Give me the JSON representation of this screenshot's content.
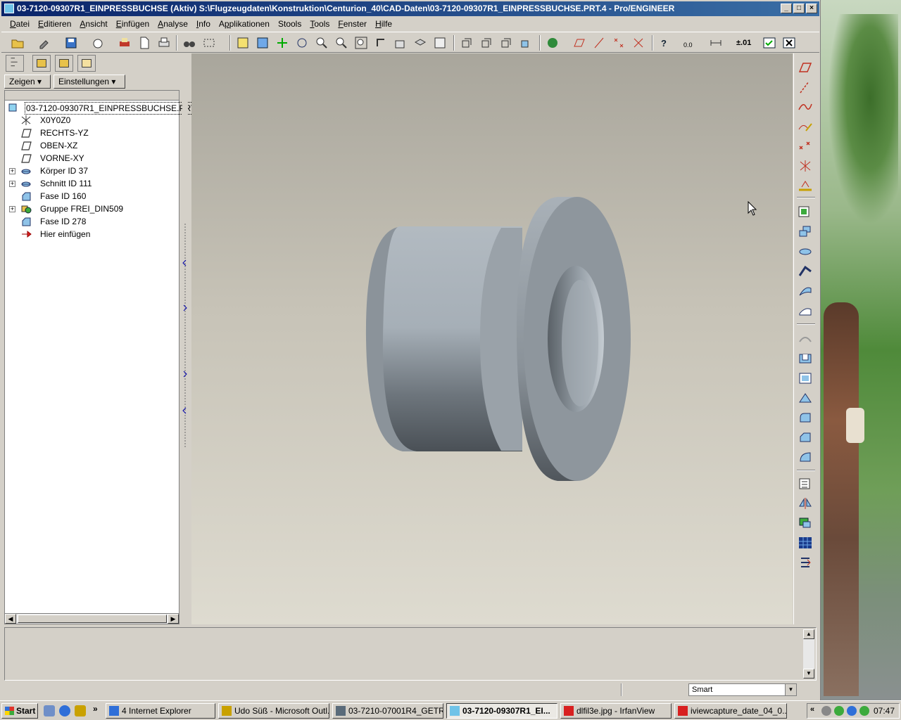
{
  "window": {
    "title": "03-7120-09307R1_EINPRESSBUCHSE (Aktiv) S:\\Flugzeugdaten\\Konstruktion\\Centurion_40\\CAD-Daten\\03-7120-09307R1_EINPRESSBUCHSE.PRT.4 - Pro/ENGINEER"
  },
  "menu": [
    {
      "pre": "",
      "u": "D",
      "post": "atei"
    },
    {
      "pre": "",
      "u": "E",
      "post": "ditieren"
    },
    {
      "pre": "",
      "u": "A",
      "post": "nsicht"
    },
    {
      "pre": "",
      "u": "E",
      "post": "infügen"
    },
    {
      "pre": "",
      "u": "A",
      "post": "nalyse"
    },
    {
      "pre": "",
      "u": "I",
      "post": "nfo"
    },
    {
      "pre": "A",
      "u": "p",
      "post": "plikationen"
    },
    {
      "pre": "Stools",
      "u": "",
      "post": ""
    },
    {
      "pre": "",
      "u": "T",
      "post": "ools"
    },
    {
      "pre": "",
      "u": "F",
      "post": "enster"
    },
    {
      "pre": "",
      "u": "H",
      "post": "ilfe"
    }
  ],
  "toolbar": {
    "precision_label": "±.01"
  },
  "tree": {
    "show_button": "Zeigen",
    "settings_button": "Einstellungen",
    "root": "03-7120-09307R1_EINPRESSBUCHSE.PRT",
    "items": [
      {
        "label": "X0Y0Z0",
        "icon": "csys-icon",
        "expandable": false
      },
      {
        "label": "RECHTS-YZ",
        "icon": "datum-plane-icon",
        "expandable": false
      },
      {
        "label": "OBEN-XZ",
        "icon": "datum-plane-icon",
        "expandable": false
      },
      {
        "label": "VORNE-XY",
        "icon": "datum-plane-icon",
        "expandable": false
      },
      {
        "label": "Körper ID 37",
        "icon": "revolve-icon",
        "expandable": true
      },
      {
        "label": "Schnitt ID 111",
        "icon": "revolve-icon",
        "expandable": true
      },
      {
        "label": "Fase ID 160",
        "icon": "chamfer-icon",
        "expandable": false
      },
      {
        "label": "Gruppe FREI_DIN509",
        "icon": "group-icon",
        "expandable": true
      },
      {
        "label": "Fase ID 278",
        "icon": "chamfer-icon",
        "expandable": false
      },
      {
        "label": "Hier einfügen",
        "icon": "insert-here-icon",
        "expandable": false
      }
    ]
  },
  "status": {
    "filter_value": "Smart"
  },
  "taskbar": {
    "start_label": "Start",
    "tasks": [
      {
        "label": "4 Internet Explorer",
        "color": "#2f6fd8"
      },
      {
        "label": "Udo Süß - Microsoft Outl...",
        "color": "#c9a100"
      },
      {
        "label": "03-7210-07001R4_GETR...",
        "color": "#5a6b7a"
      },
      {
        "label": "03-7120-09307R1_EI...",
        "color": "#6fc3e8",
        "active": true
      },
      {
        "label": "dlfil3e.jpg - IrfanView",
        "color": "#d82020"
      },
      {
        "label": "iviewcapture_date_04_0...",
        "color": "#d82020"
      }
    ],
    "clock": "07:47"
  },
  "colors": {
    "title_start": "#0a246a",
    "title_end": "#3a6ea5",
    "part_color": "#9aa3ab"
  }
}
